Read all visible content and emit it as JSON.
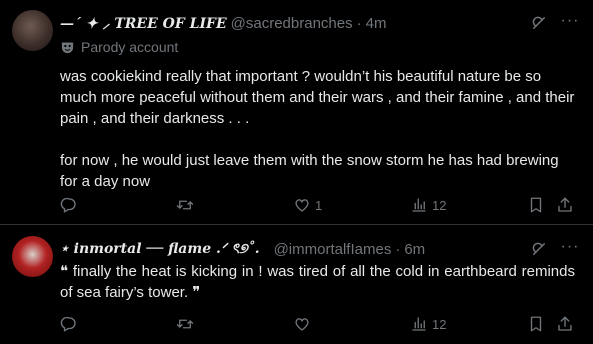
{
  "posts": [
    {
      "name": "—ˊ ✦ ⸝ TREE OF LIFE",
      "handle": "@sacredbranches",
      "dot": "·",
      "time": "4m",
      "parody_label": "Parody account",
      "paragraphs": [
        "was cookiekind really that important ? wouldn’t his beautiful nature be so much more peaceful without them and their wars , and their famine , and their pain , and their darkness . . .",
        "for now , he would just leave them with the snow storm he has had brewing for a day now"
      ],
      "actions": {
        "reply": "",
        "repost": "",
        "like": "1",
        "views": "12"
      },
      "icons": [
        "grok-icon",
        "more-icon",
        "parody-mask-icon",
        "reply-icon",
        "repost-icon",
        "like-icon",
        "views-icon",
        "bookmark-icon",
        "share-icon"
      ]
    },
    {
      "name": "⋆ inmortal ── flame .ᐟ ৎ୭˚.",
      "handle": "@immortalfIames",
      "dot": "·",
      "time": "6m",
      "paragraphs": [
        "❝ finally the heat is kicking in ! was tired of all the cold in earthbeard reminds of sea fairy’s tower. ❞"
      ],
      "actions": {
        "reply": "",
        "repost": "",
        "like": "",
        "views": "12"
      }
    }
  ],
  "colors": {
    "background": "#000000",
    "text": "#e7e9ea",
    "muted": "#71767b",
    "divider": "#2f3336"
  }
}
